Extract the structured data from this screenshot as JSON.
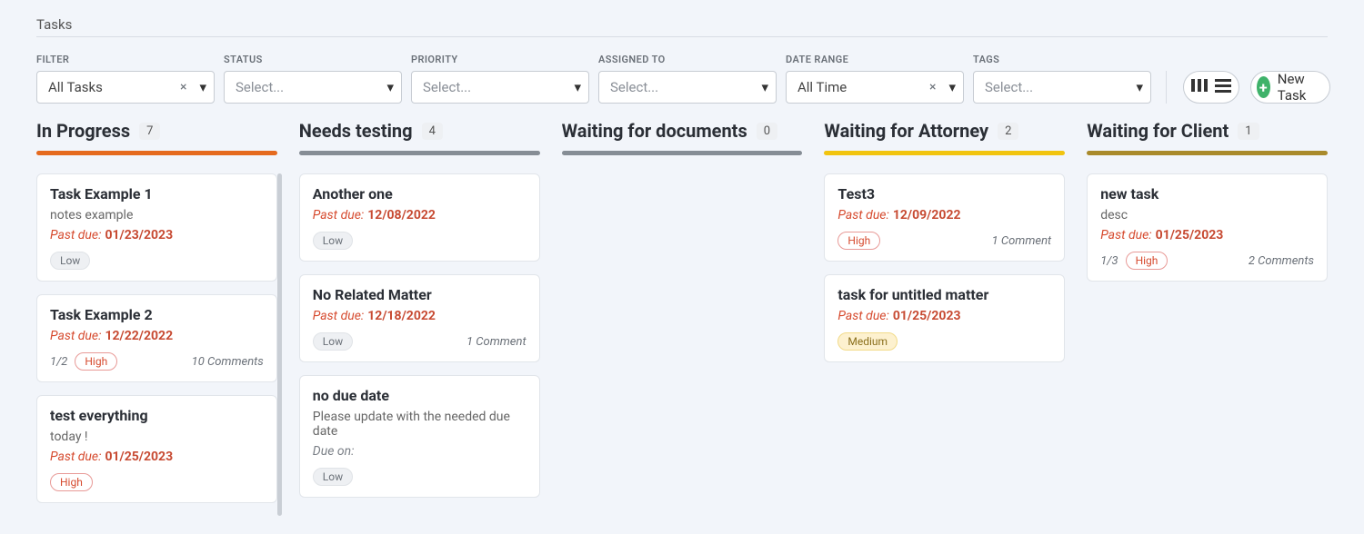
{
  "page_title": "Tasks",
  "filters": {
    "filter": {
      "label": "FILTER",
      "value": "All Tasks",
      "clearable": true
    },
    "status": {
      "label": "STATUS",
      "placeholder": "Select..."
    },
    "priority": {
      "label": "PRIORITY",
      "placeholder": "Select..."
    },
    "assigned_to": {
      "label": "ASSIGNED TO",
      "placeholder": "Select..."
    },
    "date_range": {
      "label": "DATE RANGE",
      "value": "All Time",
      "clearable": true
    },
    "tags": {
      "label": "TAGS",
      "placeholder": "Select..."
    }
  },
  "new_task_label": "New Task",
  "columns": [
    {
      "title": "In Progress",
      "count": "7",
      "bar": "bar-orange",
      "has_scroll": true,
      "cards": [
        {
          "title": "Task Example 1",
          "desc": "notes example",
          "past_due_label": "Past due:",
          "due": "01/23/2023",
          "priority": "Low"
        },
        {
          "title": "Task Example 2",
          "past_due_label": "Past due:",
          "due": "12/22/2022",
          "progress": "1/2",
          "priority": "High",
          "comments": "10 Comments"
        },
        {
          "title": "test everything",
          "desc": "today !",
          "past_due_label": "Past due:",
          "due": "01/25/2023",
          "priority": "High"
        }
      ]
    },
    {
      "title": "Needs testing",
      "count": "4",
      "bar": "bar-grey",
      "cards": [
        {
          "title": "Another one",
          "past_due_label": "Past due:",
          "due": "12/08/2022",
          "priority": "Low"
        },
        {
          "title": "No Related Matter",
          "past_due_label": "Past due:",
          "due": "12/18/2022",
          "priority": "Low",
          "comments": "1 Comment"
        },
        {
          "title": "no due date",
          "desc": "Please update with the needed due date",
          "due_on_label": "Due on:",
          "priority": "Low"
        }
      ]
    },
    {
      "title": "Waiting for documents",
      "count": "0",
      "bar": "bar-grey",
      "cards": []
    },
    {
      "title": "Waiting for Attorney",
      "count": "2",
      "bar": "bar-yellow",
      "cards": [
        {
          "title": "Test3",
          "past_due_label": "Past due:",
          "due": "12/09/2022",
          "priority": "High",
          "comments": "1 Comment"
        },
        {
          "title": "task for untitled matter",
          "past_due_label": "Past due:",
          "due": "01/25/2023",
          "priority": "Medium"
        }
      ]
    },
    {
      "title": "Waiting for Client",
      "count": "1",
      "bar": "bar-olive",
      "cards": [
        {
          "title": "new task",
          "desc": "desc",
          "past_due_label": "Past due:",
          "due": "01/25/2023",
          "progress": "1/3",
          "priority": "High",
          "comments": "2 Comments"
        }
      ]
    }
  ]
}
